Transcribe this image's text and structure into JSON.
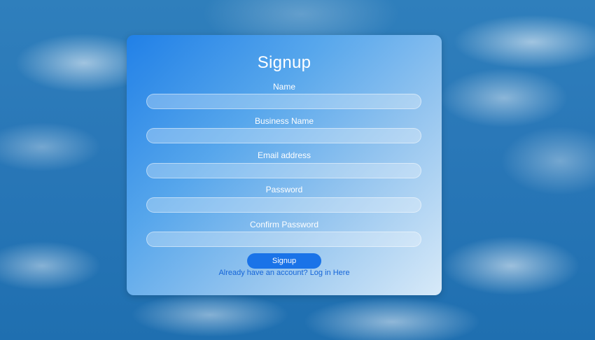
{
  "form": {
    "title": "Signup",
    "fields": [
      {
        "label": "Name",
        "value": "",
        "placeholder": ""
      },
      {
        "label": "Business Name",
        "value": "",
        "placeholder": ""
      },
      {
        "label": "Email address",
        "value": "",
        "placeholder": ""
      },
      {
        "label": "Password",
        "value": "",
        "placeholder": ""
      },
      {
        "label": "Confirm Password",
        "value": "",
        "placeholder": ""
      }
    ],
    "submit_label": "Signup",
    "login_link_text": "Already have an account? Log in Here"
  },
  "colors": {
    "button": "#1a73e8",
    "link": "#1565d8",
    "card_gradient_start": "#2080e8",
    "card_gradient_end": "#e1f0fc"
  }
}
